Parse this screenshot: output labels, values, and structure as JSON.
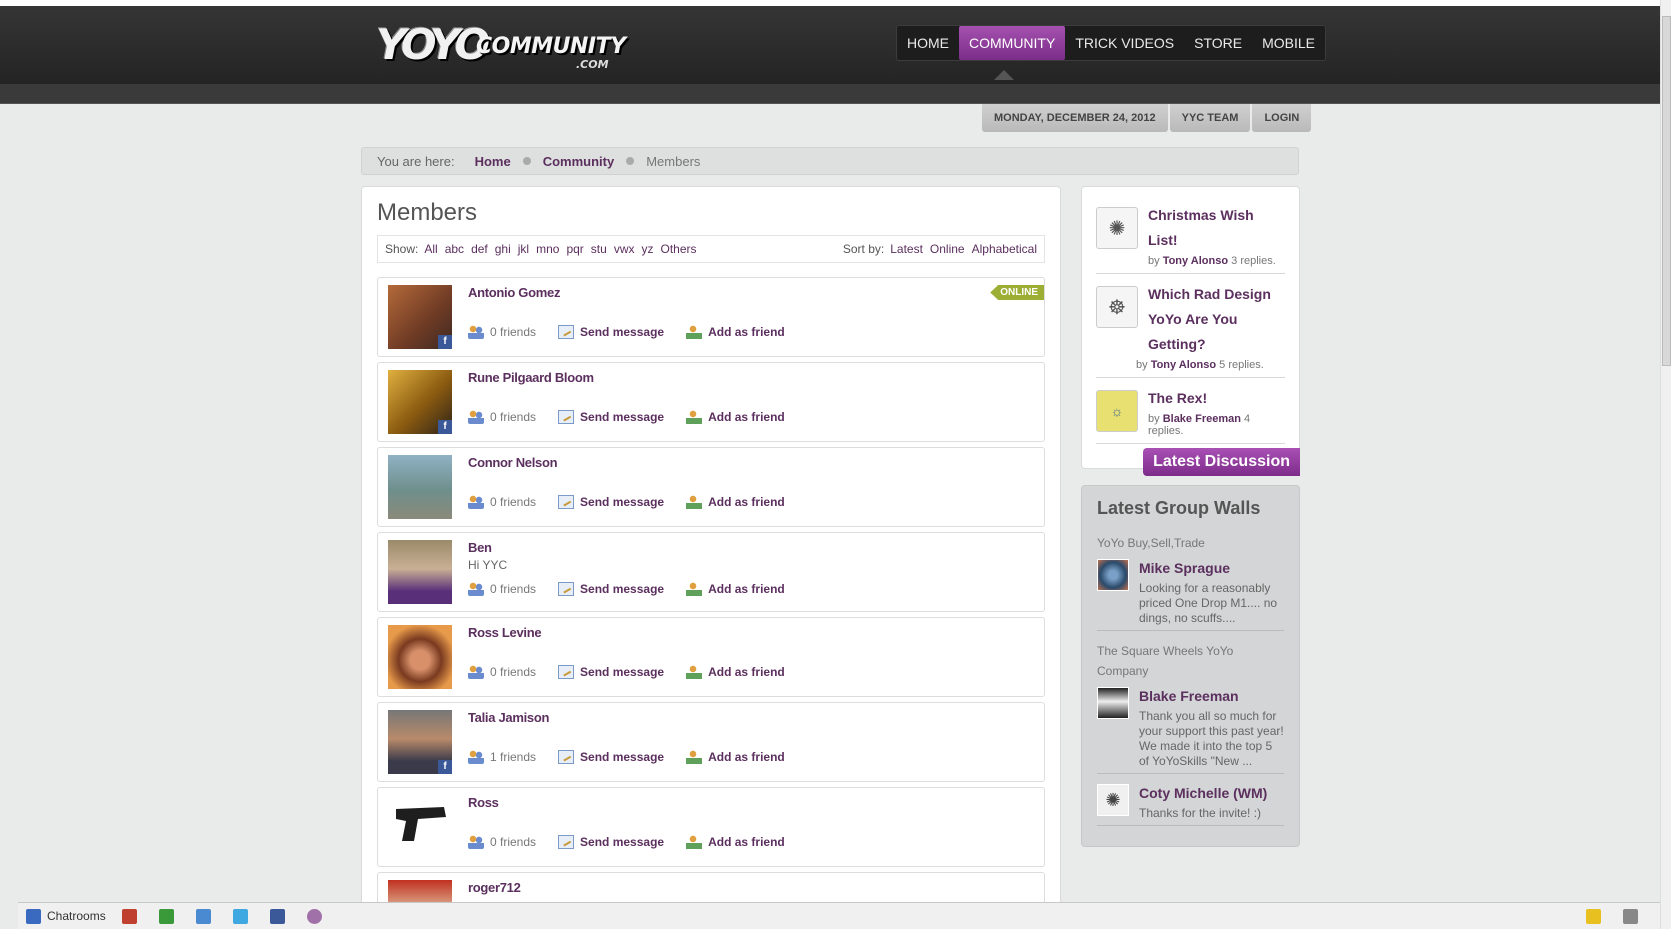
{
  "site": {
    "logo_main": "YOYO",
    "logo_community": "COMMUNITY",
    "logo_suffix": ".COM"
  },
  "nav": {
    "items": [
      {
        "label": "HOME"
      },
      {
        "label": "COMMUNITY"
      },
      {
        "label": "TRICK VIDEOS"
      },
      {
        "label": "STORE"
      },
      {
        "label": "MOBILE"
      }
    ],
    "active": "COMMUNITY"
  },
  "toptabs": {
    "date": "MONDAY, DECEMBER 24, 2012",
    "team": "YYC TEAM",
    "login": "LOGIN"
  },
  "breadcrumb": {
    "label": "You are here:",
    "items": [
      "Home",
      "Community",
      "Members"
    ]
  },
  "main": {
    "title": "Members",
    "show_label": "Show:",
    "filters": [
      "All",
      "abc",
      "def",
      "ghi",
      "jkl",
      "mno",
      "pqr",
      "stu",
      "vwx",
      "yz",
      "Others"
    ],
    "sort_label": "Sort by:",
    "sorts": [
      "Latest",
      "Online",
      "Alphabetical"
    ]
  },
  "members": [
    {
      "name": "Antonio Gomez",
      "status": "",
      "friends": "0 friends",
      "online": "ONLINE",
      "fb": true
    },
    {
      "name": "Rune Pilgaard Bloom",
      "status": "",
      "friends": "0 friends",
      "online": "",
      "fb": true
    },
    {
      "name": "Connor Nelson",
      "status": "",
      "friends": "0 friends",
      "online": "",
      "fb": false
    },
    {
      "name": "Ben",
      "status": "Hi YYC",
      "friends": "0 friends",
      "online": "",
      "fb": false
    },
    {
      "name": "Ross Levine",
      "status": "",
      "friends": "0 friends",
      "online": "",
      "fb": false
    },
    {
      "name": "Talia Jamison",
      "status": "",
      "friends": "1 friends",
      "online": "",
      "fb": true
    },
    {
      "name": "Ross",
      "status": "",
      "friends": "0 friends",
      "online": "",
      "fb": false
    },
    {
      "name": "roger712",
      "status": "",
      "friends": "",
      "online": "",
      "fb": false
    }
  ],
  "actions": {
    "send_message": "Send message",
    "add_friend": "Add as friend"
  },
  "discussions": {
    "items": [
      {
        "title": "Christmas Wish List!",
        "by_label": "by",
        "author": "Tony Alonso",
        "replies": "3 replies."
      },
      {
        "title": "Which Rad Design YoYo Are You Getting?",
        "by_label": "by",
        "author": "Tony Alonso",
        "replies": "5 replies."
      },
      {
        "title": "The Rex!",
        "by_label": "by",
        "author": "Blake Freeman",
        "replies": "4 replies."
      }
    ],
    "button": "Latest Discussion"
  },
  "groupwalls": {
    "title": "Latest Group Walls",
    "groups": [
      {
        "name": "YoYo Buy,Sell,Trade",
        "posts": [
          {
            "author": "Mike Sprague",
            "text": "Looking for a reasonably priced One Drop M1.... no dings, no scuffs...."
          }
        ]
      },
      {
        "name": "The Square Wheels YoYo Company",
        "posts": [
          {
            "author": "Blake Freeman",
            "text": "Thank you all so much for your support this past year! We made it into the top 5 of YoYoSkills \"New ..."
          },
          {
            "author": "Coty Michelle (WM)",
            "text": "Thanks for the invite! :)"
          }
        ]
      }
    ]
  },
  "footer": {
    "chatrooms": "Chatrooms"
  }
}
